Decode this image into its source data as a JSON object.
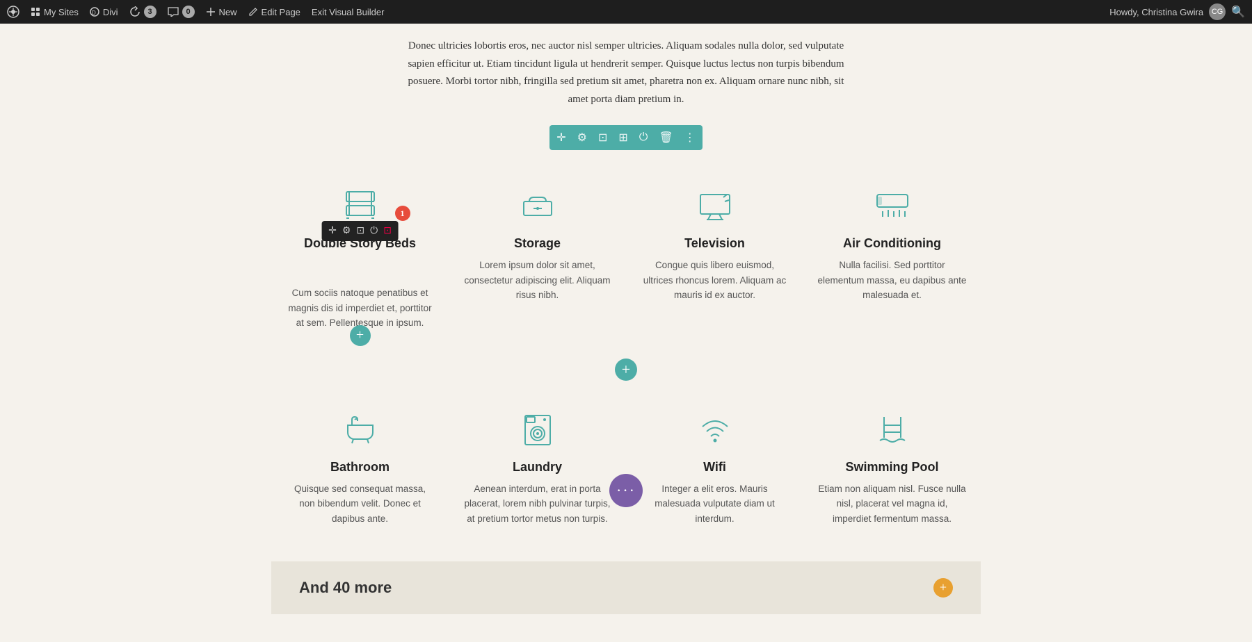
{
  "topbar": {
    "wp_icon": "W",
    "my_sites_label": "My Sites",
    "divi_label": "Divi",
    "updates_count": "3",
    "comments_count": "0",
    "new_label": "New",
    "edit_page_label": "Edit Page",
    "exit_vb_label": "Exit Visual Builder",
    "user_label": "Howdy, Christina Gwira",
    "search_icon": "🔍"
  },
  "intro": {
    "text1": "Donec ultricies lobortis eros, nec auctor nisl semper ultricies. Aliquam sodales nulla dolor, sed vulputate",
    "text2": "sapien efficitur ut. Etiam tincidunt ligula ut hendrerit semper. Quisque luctus lectus non turpis bibendum",
    "text3": "posuere. Morbi tortor nibh, fringilla sed pretium sit amet, pharetra non ex. Aliquam ornare nunc nibh, sit",
    "text4": "amet porta diam pretium in."
  },
  "features_row1": [
    {
      "id": "double-story-beds",
      "title": "Double Story Beds",
      "desc": "Cum sociis natoque penatibus et magnis dis id imperdiet et, porttitor at sem. Pellentesque in ipsum.",
      "selected": true
    },
    {
      "id": "storage",
      "title": "Storage",
      "desc": "Lorem ipsum dolor sit amet, consectetur adipiscing elit. Aliquam risus nibh.",
      "selected": false
    },
    {
      "id": "television",
      "title": "Television",
      "desc": "Congue quis libero euismod, ultrices rhoncus lorem. Aliquam ac mauris id ex auctor.",
      "selected": false
    },
    {
      "id": "air-conditioning",
      "title": "Air Conditioning",
      "desc": "Nulla facilisi. Sed porttitor elementum massa, eu dapibus ante malesuada et.",
      "selected": false
    }
  ],
  "features_row2": [
    {
      "id": "bathroom",
      "title": "Bathroom",
      "desc": "Quisque sed consequat massa, non bibendum velit. Donec et dapibus ante.",
      "selected": false
    },
    {
      "id": "laundry",
      "title": "Laundry",
      "desc": "Aenean interdum, erat in porta placerat, lorem nibh pulvinar turpis, at pretium tortor metus non turpis.",
      "selected": false
    },
    {
      "id": "wifi",
      "title": "Wifi",
      "desc": "Integer a elit eros. Mauris malesuada vulputate diam ut interdum.",
      "selected": false
    },
    {
      "id": "swimming-pool",
      "title": "Swimming Pool",
      "desc": "Etiam non aliquam nisl. Fusce nulla nisl, placerat vel magna id, imperdiet fermentum massa.",
      "selected": false
    }
  ],
  "and_more": {
    "label": "And 40 more"
  },
  "badge": "1"
}
